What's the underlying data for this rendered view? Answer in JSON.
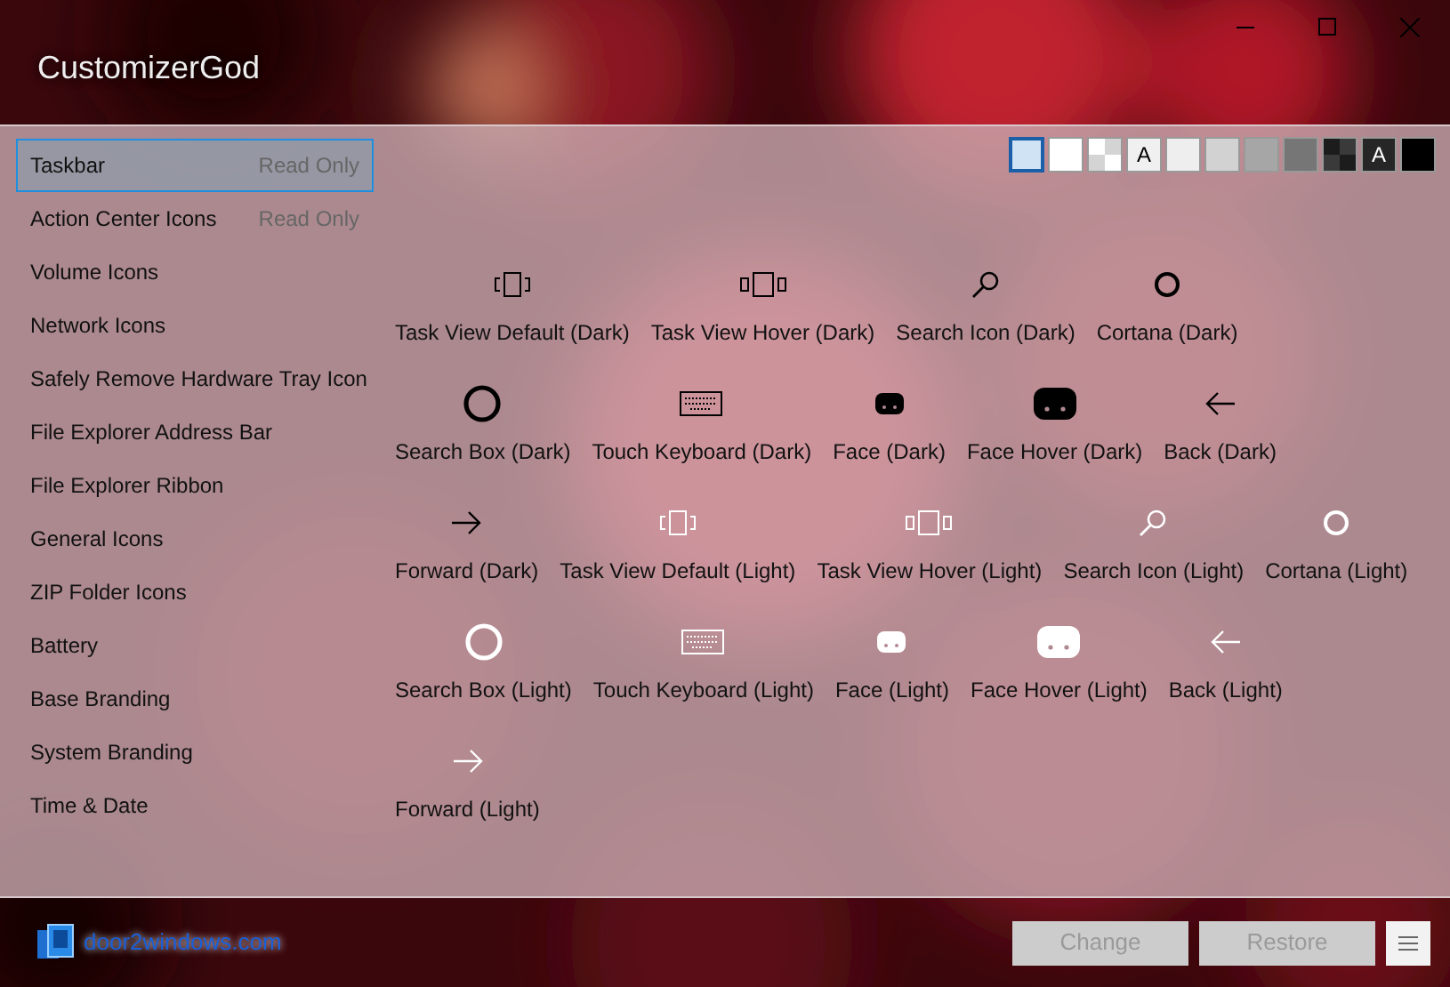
{
  "window": {
    "title": "CustomizerGod"
  },
  "swatches": [
    {
      "kind": "solid",
      "color": "#cfe3f5",
      "selected": true
    },
    {
      "kind": "solid",
      "color": "#ffffff",
      "selected": false
    },
    {
      "kind": "checker",
      "color": "#ffffff",
      "selected": false
    },
    {
      "kind": "letter",
      "color": "#f0f0f0",
      "label": "A",
      "selected": false
    },
    {
      "kind": "solid",
      "color": "#eeeeee",
      "selected": false
    },
    {
      "kind": "solid",
      "color": "#d2d2d2",
      "selected": false
    },
    {
      "kind": "solid",
      "color": "#a6a6a6",
      "selected": false
    },
    {
      "kind": "solid",
      "color": "#767676",
      "selected": false
    },
    {
      "kind": "checker",
      "color": "#1c1c1c",
      "selected": false
    },
    {
      "kind": "letter",
      "color": "#262626",
      "label": "A",
      "selected": false
    },
    {
      "kind": "solid",
      "color": "#000000",
      "selected": false
    }
  ],
  "sidebar": {
    "items": [
      {
        "label": "Taskbar",
        "note": "Read Only",
        "selected": true
      },
      {
        "label": "Action Center Icons",
        "note": "Read Only",
        "selected": false
      },
      {
        "label": "Volume Icons",
        "selected": false
      },
      {
        "label": "Network Icons",
        "selected": false
      },
      {
        "label": "Safely Remove Hardware Tray Icon",
        "selected": false
      },
      {
        "label": "File Explorer Address Bar",
        "selected": false
      },
      {
        "label": "File Explorer Ribbon",
        "selected": false
      },
      {
        "label": "General Icons",
        "selected": false
      },
      {
        "label": "ZIP Folder Icons",
        "selected": false
      },
      {
        "label": "Battery",
        "selected": false
      },
      {
        "label": "Base Branding",
        "selected": false
      },
      {
        "label": "System Branding",
        "selected": false
      },
      {
        "label": "Time & Date",
        "selected": false
      }
    ]
  },
  "icon_rows": [
    [
      {
        "kind": "taskview",
        "color": "#000000",
        "label": "Task View Default (Dark)"
      },
      {
        "kind": "taskview-wide",
        "color": "#000000",
        "label": "Task View Hover (Dark)"
      },
      {
        "kind": "search",
        "color": "#000000",
        "label": "Search Icon (Dark)"
      },
      {
        "kind": "ring",
        "color": "#000000",
        "label": "Cortana (Dark)"
      }
    ],
    [
      {
        "kind": "ring-large",
        "color": "#000000",
        "label": "Search Box (Dark)"
      },
      {
        "kind": "keyboard",
        "color": "#000000",
        "label": "Touch Keyboard (Dark)"
      },
      {
        "kind": "face",
        "color": "#000000",
        "label": "Face (Dark)"
      },
      {
        "kind": "face-large",
        "color": "#000000",
        "label": "Face Hover (Dark)"
      },
      {
        "kind": "back",
        "color": "#000000",
        "label": "Back (Dark)"
      }
    ],
    [
      {
        "kind": "forward",
        "color": "#000000",
        "label": "Forward (Dark)"
      },
      {
        "kind": "taskview",
        "color": "#ffffff",
        "label": "Task View Default (Light)"
      },
      {
        "kind": "taskview-wide",
        "color": "#ffffff",
        "label": "Task View Hover (Light)"
      },
      {
        "kind": "search",
        "color": "#ffffff",
        "label": "Search Icon (Light)"
      },
      {
        "kind": "ring",
        "color": "#ffffff",
        "label": "Cortana (Light)"
      }
    ],
    [
      {
        "kind": "ring-large",
        "color": "#ffffff",
        "label": "Search Box (Light)"
      },
      {
        "kind": "keyboard",
        "color": "#ffffff",
        "label": "Touch Keyboard (Light)"
      },
      {
        "kind": "face",
        "color": "#ffffff",
        "label": "Face (Light)"
      },
      {
        "kind": "face-large",
        "color": "#ffffff",
        "label": "Face Hover (Light)"
      },
      {
        "kind": "back",
        "color": "#ffffff",
        "label": "Back (Light)"
      }
    ],
    [
      {
        "kind": "forward",
        "color": "#ffffff",
        "label": "Forward (Light)"
      }
    ]
  ],
  "footer": {
    "link": "door2windows.com",
    "buttons": [
      {
        "label": "Change",
        "disabled": true
      },
      {
        "label": "Restore",
        "disabled": true
      }
    ]
  }
}
